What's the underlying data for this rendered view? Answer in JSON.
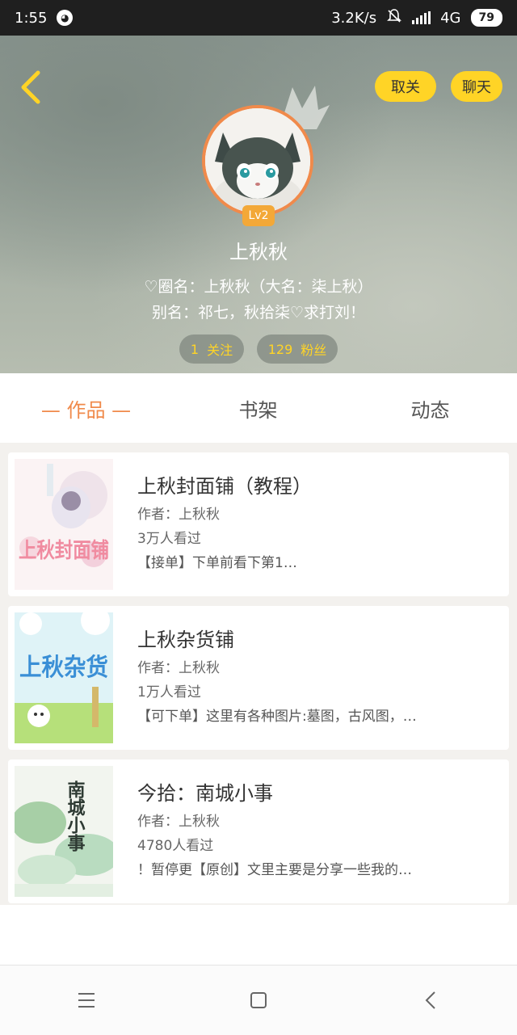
{
  "status_bar": {
    "time": "1:55",
    "network_speed": "3.2K/s",
    "network_type": "4G",
    "battery": "79"
  },
  "header": {
    "back_label": "‹",
    "unfollow_label": "取关",
    "chat_label": "聊天",
    "level": "Lv2",
    "username": "上秋秋",
    "bio_line1": "♡圈名：上秋秋（大名：柒上秋）",
    "bio_line2": "别名：祁七，秋拾柒♡求打刘！",
    "follow_count": "1",
    "follow_label": "关注",
    "fans_count": "129",
    "fans_label": "粉丝"
  },
  "tabs": [
    {
      "label": "— 作品 —",
      "active": true
    },
    {
      "label": "书架",
      "active": false
    },
    {
      "label": "动态",
      "active": false
    }
  ],
  "works": [
    {
      "title": "上秋封面铺（教程）",
      "author": "作者：上秋秋",
      "views": "3万人看过",
      "desc": "【接单】下单前看下第1…",
      "cover_text": "上秋封面铺"
    },
    {
      "title": "上秋杂货铺",
      "author": "作者：上秋秋",
      "views": "1万人看过",
      "desc": "【可下单】这里有各种图片:墓图，古风图，…",
      "cover_text": "上秋杂货"
    },
    {
      "title": "今拾：南城小事",
      "author": "作者：上秋秋",
      "views": "4780人看过",
      "desc": "！暂停更【原创】文里主要是分享一些我的…",
      "cover_text": "南城小事"
    }
  ],
  "colors": {
    "accent_yellow": "#ffd426",
    "accent_orange": "#f08a4b"
  }
}
